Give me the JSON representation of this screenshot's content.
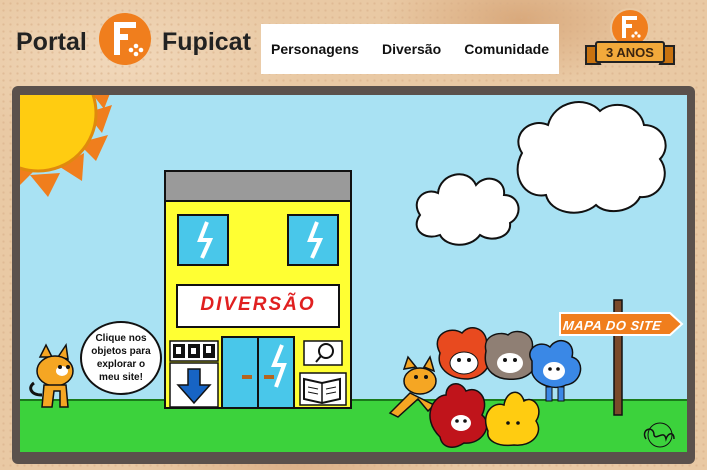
{
  "header": {
    "logo_left": "Portal",
    "logo_right": "Fupicat",
    "logo_mark": "F"
  },
  "nav": {
    "items": [
      {
        "label": "Personagens"
      },
      {
        "label": "Diversão"
      },
      {
        "label": "Comunidade"
      }
    ]
  },
  "badge": {
    "mark": "F",
    "text": "3 ANOS"
  },
  "scene": {
    "speech": "Clique nos objetos para explorar o meu site!",
    "building_sign": "DIVERSÃO",
    "site_map_sign": "MAPA DO SITE"
  },
  "colors": {
    "sky": "#a9e2f3",
    "grass": "#3cd23c",
    "building": "#ffff33",
    "sun": "#ffcc11",
    "accent_orange": "#f07e1d",
    "frame": "#5b514c"
  }
}
